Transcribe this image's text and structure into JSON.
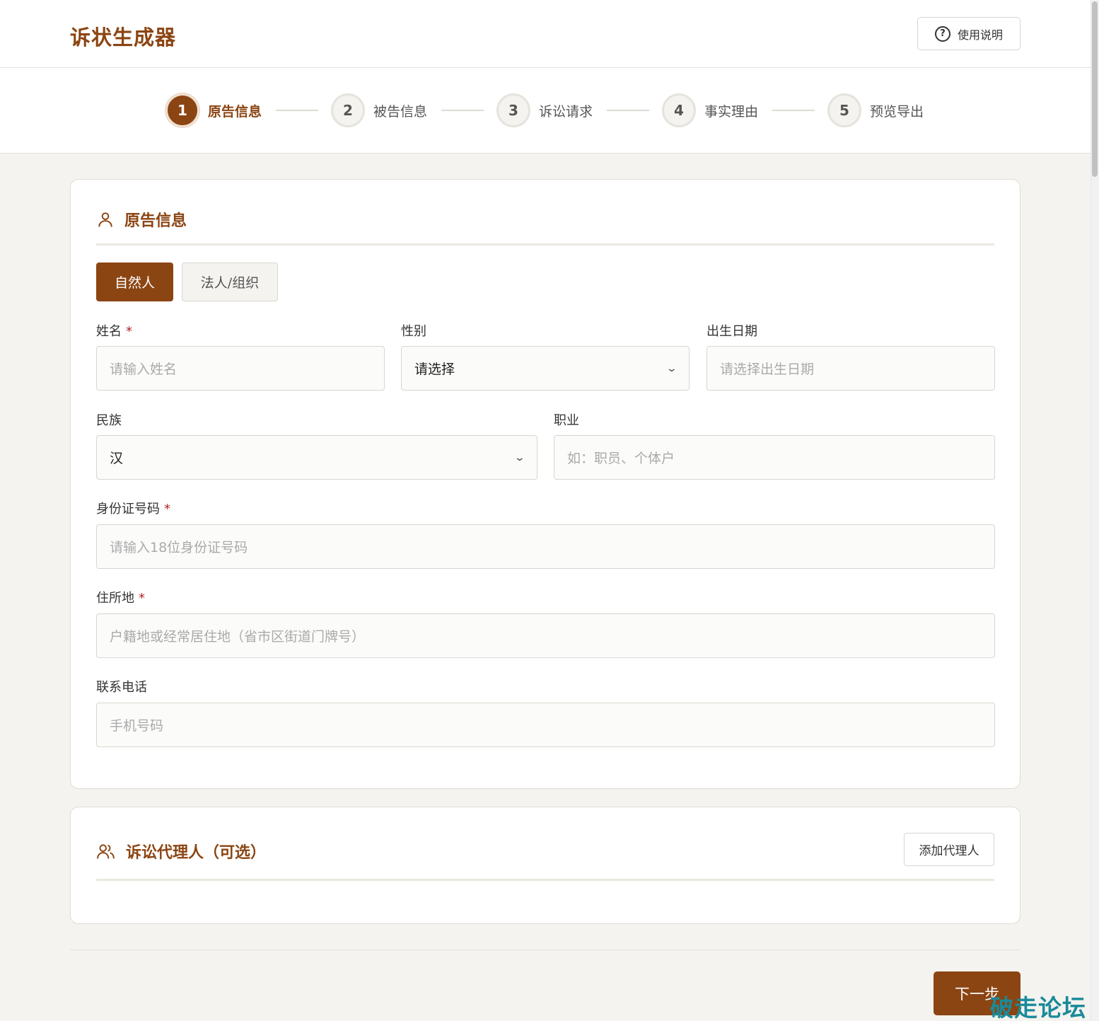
{
  "header": {
    "title": "诉状生成器",
    "help_label": "使用说明"
  },
  "steps": [
    {
      "number": "1",
      "label": "原告信息",
      "active": true
    },
    {
      "number": "2",
      "label": "被告信息",
      "active": false
    },
    {
      "number": "3",
      "label": "诉讼请求",
      "active": false
    },
    {
      "number": "4",
      "label": "事实理由",
      "active": false
    },
    {
      "number": "5",
      "label": "预览导出",
      "active": false
    }
  ],
  "plaintiff": {
    "title": "原告信息",
    "tabs": [
      "自然人",
      "法人/组织"
    ],
    "required_mark": "*",
    "name": {
      "label": "姓名",
      "placeholder": "请输入姓名"
    },
    "gender": {
      "label": "性别",
      "value": "请选择"
    },
    "birth": {
      "label": "出生日期",
      "placeholder": "请选择出生日期"
    },
    "ethnicity": {
      "label": "民族",
      "value": "汉"
    },
    "occupation": {
      "label": "职业",
      "placeholder": "如：职员、个体户"
    },
    "id_number": {
      "label": "身份证号码",
      "placeholder": "请输入18位身份证号码"
    },
    "address": {
      "label": "住所地",
      "placeholder": "户籍地或经常居住地（省市区街道门牌号）"
    },
    "phone": {
      "label": "联系电话",
      "placeholder": "手机号码"
    }
  },
  "agent": {
    "title": "诉讼代理人（可选）",
    "add_label": "添加代理人"
  },
  "footer": {
    "next_label": "下一步"
  },
  "watermark": "破走论坛",
  "colors": {
    "accent": "#8b4513",
    "background": "#f4f3ef",
    "required": "#b22222"
  }
}
